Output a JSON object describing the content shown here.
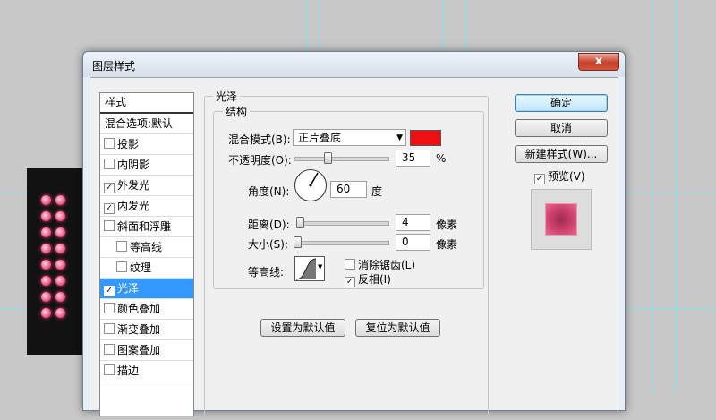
{
  "dialog": {
    "title": "图层样式",
    "close_label": "x"
  },
  "styles": {
    "header": "样式",
    "blend_options": "混合选项:默认",
    "items": [
      {
        "label": "投影",
        "checked": false
      },
      {
        "label": "内阴影",
        "checked": false
      },
      {
        "label": "外发光",
        "checked": true
      },
      {
        "label": "内发光",
        "checked": true
      },
      {
        "label": "斜面和浮雕",
        "checked": false
      },
      {
        "label": "等高线",
        "checked": false
      },
      {
        "label": "纹理",
        "checked": false
      },
      {
        "label": "光泽",
        "checked": true
      },
      {
        "label": "颜色叠加",
        "checked": false
      },
      {
        "label": "渐变叠加",
        "checked": false
      },
      {
        "label": "图案叠加",
        "checked": false
      },
      {
        "label": "描边",
        "checked": false
      }
    ]
  },
  "gloss": {
    "group_title": "光泽",
    "structure_title": "结构",
    "blend_mode_label": "混合模式(B):",
    "blend_mode_value": "正片叠底",
    "blend_color": "#ee1111",
    "opacity_label": "不透明度(O):",
    "opacity_value": "35",
    "opacity_unit": "%",
    "opacity_fraction": 0.35,
    "angle_label": "角度(N):",
    "angle_value": "60",
    "angle_unit": "度",
    "distance_label": "距离(D):",
    "distance_value": "4",
    "distance_unit": "像素",
    "size_label": "大小(S):",
    "size_value": "0",
    "size_unit": "像素",
    "contour_label": "等高线:",
    "antialias_label": "消除锯齿(L)",
    "antialias_checked": false,
    "invert_label": "反相(I)",
    "invert_checked": true,
    "set_default_label": "设置为默认值",
    "reset_default_label": "复位为默认值"
  },
  "buttons": {
    "ok": "确定",
    "cancel": "取消",
    "new_style": "新建样式(W)...",
    "preview_label": "预览(V)",
    "preview_checked": true
  },
  "colors": {
    "selection": "#3399ff",
    "guide": "#7fe3ea",
    "dot": "#f4729a"
  }
}
